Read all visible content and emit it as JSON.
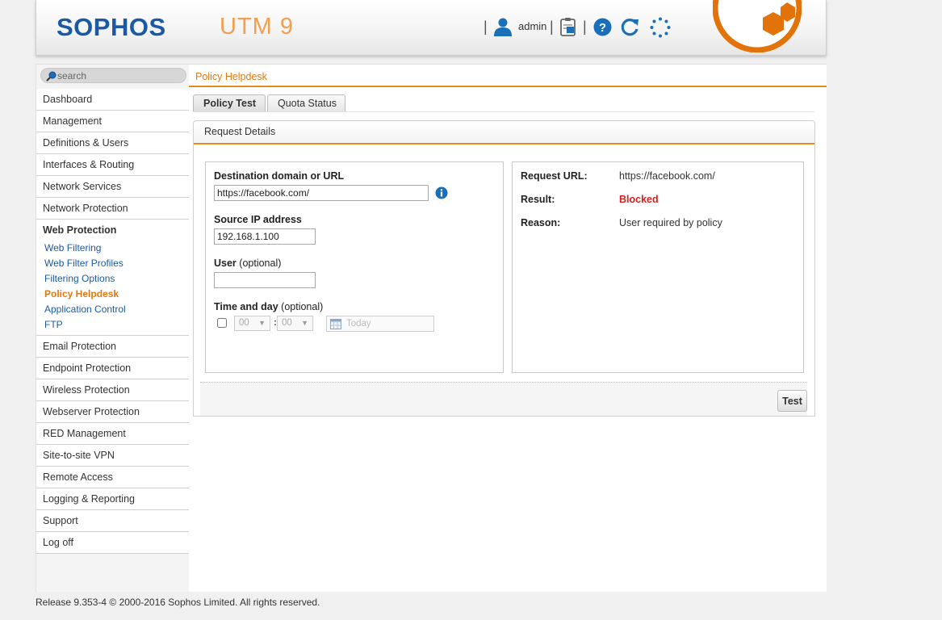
{
  "header": {
    "brand": "SOPHOS",
    "product": "UTM 9",
    "separator": "|",
    "user": "admin"
  },
  "sidebar": {
    "search_placeholder": "search",
    "items_top": [
      "Dashboard",
      "Management",
      "Definitions & Users",
      "Interfaces & Routing",
      "Network Services",
      "Network Protection"
    ],
    "section": {
      "title": "Web Protection",
      "subitems": [
        "Web Filtering",
        "Web Filter Profiles",
        "Filtering Options",
        "Policy Helpdesk",
        "Application Control",
        "FTP"
      ]
    },
    "items_bottom": [
      "Email Protection",
      "Endpoint Protection",
      "Wireless Protection",
      "Webserver Protection",
      "RED Management",
      "Site-to-site VPN",
      "Remote Access",
      "Logging & Reporting",
      "Support",
      "Log off"
    ]
  },
  "breadcrumb": "Policy Helpdesk",
  "tabs": [
    "Policy Test",
    "Quota Status"
  ],
  "panel": {
    "title": "Request Details",
    "form": {
      "dest_label": "Destination domain or URL",
      "dest_value": "https://facebook.com/",
      "ip_label": "Source IP address",
      "ip_value": "192.168.1.100",
      "user_label": "User",
      "user_optional": "(optional)",
      "user_value": "",
      "time_label": "Time and day",
      "time_optional": "(optional)",
      "hour": "00",
      "minute": "00",
      "colon": ":",
      "date_placeholder": "Today"
    },
    "result": {
      "url_label": "Request URL:",
      "url_value": "https://facebook.com/",
      "result_label": "Result:",
      "result_value": "Blocked",
      "reason_label": "Reason:",
      "reason_value": "User required by policy"
    },
    "test_button": "Test"
  },
  "footer": "Release 9.353-4  © 2000-2016 Sophos Limited. All rights reserved.",
  "colors": {
    "brand_blue": "#1b5aa3",
    "accent_orange": "#e07a10",
    "blocked_red": "#d62020"
  }
}
